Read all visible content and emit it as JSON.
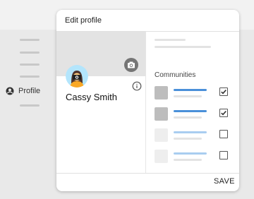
{
  "sidebar": {
    "profile_label": "Profile"
  },
  "dialog": {
    "title": "Edit profile",
    "name": "Cassy Smith",
    "communities_label": "Communities",
    "communities": [
      {
        "checked": true,
        "bar_color": "#4a90d9",
        "thumb_color": "#bdbdbd"
      },
      {
        "checked": true,
        "bar_color": "#4a90d9",
        "thumb_color": "#bdbdbd"
      },
      {
        "checked": false,
        "bar_color": "#a9cdf0",
        "thumb_color": "#eeeeee"
      },
      {
        "checked": false,
        "bar_color": "#a9cdf0",
        "thumb_color": "#eeeeee"
      }
    ],
    "save_label": "SAVE"
  },
  "icons": {
    "profile": "account-circle-icon",
    "camera": "camera-icon",
    "info": "info-icon",
    "check": "check-icon"
  }
}
